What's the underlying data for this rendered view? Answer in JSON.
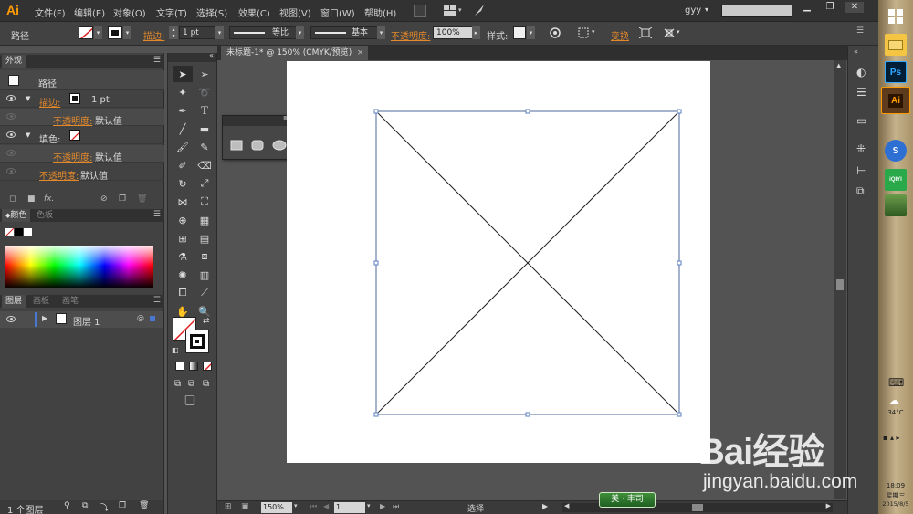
{
  "app": {
    "logo": "Ai"
  },
  "menubar": {
    "items": [
      "文件(F)",
      "编辑(E)",
      "对象(O)",
      "文字(T)",
      "选择(S)",
      "效果(C)",
      "视图(V)",
      "窗口(W)",
      "帮助(H)"
    ],
    "workspace": "gyy",
    "search_placeholder": ""
  },
  "controlbar": {
    "selection_label": "路径",
    "stroke_label": "描边:",
    "stroke_weight": "1 pt",
    "variable_width": "等比",
    "brush": "基本",
    "opacity_label": "不透明度:",
    "opacity_value": "100%",
    "style_label": "样式:",
    "transform_label": "变换"
  },
  "appearance_panel": {
    "tab": "外观",
    "object": "路径",
    "rows": [
      {
        "label": "描边:",
        "value": "1 pt"
      },
      {
        "label": "不透明度:",
        "value": "默认值"
      },
      {
        "label": "填色:",
        "value": ""
      },
      {
        "label": "不透明度:",
        "value": "默认值"
      },
      {
        "label": "不透明度:",
        "value": "默认值"
      }
    ],
    "fx_label": "fx."
  },
  "color_panel": {
    "tabs": [
      "颜色",
      "色板"
    ]
  },
  "layers_panel": {
    "tabs": [
      "图层",
      "画板",
      "画笔"
    ],
    "layer_name": "图层 1",
    "footer": "1 个图层"
  },
  "document": {
    "tab_title": "未标题-1* @ 150% (CMYK/预览)",
    "close": "×"
  },
  "statusbar": {
    "zoom": "150%",
    "artboard_num": "1",
    "tool_status": "选择"
  },
  "taskbar": {
    "weather": "34°C",
    "time": "18:09",
    "weekday": "星期三",
    "date": "2015/8/5",
    "apps": [
      "Ps",
      "Ai",
      "S",
      "iQIYI"
    ]
  },
  "watermark": {
    "brand": "Bai经验",
    "url": "jingyan.baidu.com",
    "badge": "美 · 丰司"
  },
  "colors": {
    "accent_orange": "#e4892a",
    "panel_bg": "#424242",
    "canvas_bg": "#535353",
    "selection_blue": "#5b7fc0"
  }
}
